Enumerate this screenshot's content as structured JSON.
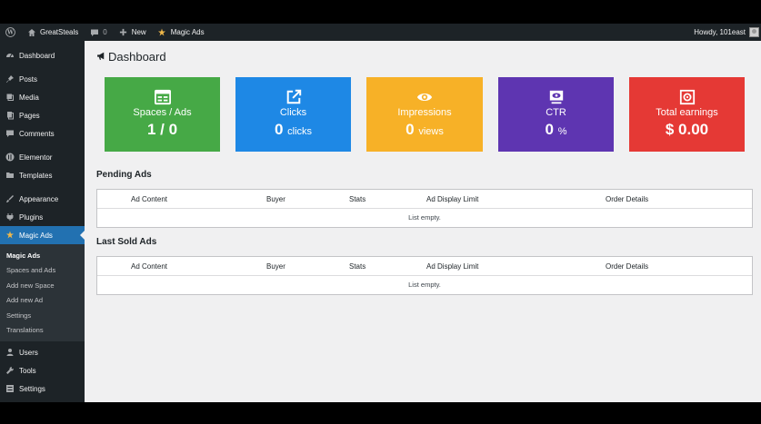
{
  "adminbar": {
    "site_name": "GreatSteals",
    "comments_count": "0",
    "new_label": "New",
    "plugin_label": "Magic Ads",
    "greeting": "Howdy, 101east"
  },
  "sidebar": {
    "items": [
      {
        "label": "Dashboard",
        "icon": "dashboard-icon"
      },
      {
        "label": "Posts",
        "icon": "pin-icon"
      },
      {
        "label": "Media",
        "icon": "media-icon"
      },
      {
        "label": "Pages",
        "icon": "pages-icon"
      },
      {
        "label": "Comments",
        "icon": "comments-icon"
      },
      {
        "label": "Elementor",
        "icon": "elementor-icon"
      },
      {
        "label": "Templates",
        "icon": "folder-icon"
      },
      {
        "label": "Appearance",
        "icon": "brush-icon"
      },
      {
        "label": "Plugins",
        "icon": "plug-icon"
      },
      {
        "label": "Magic Ads",
        "icon": "star-icon"
      }
    ],
    "submenu": [
      "Magic Ads",
      "Spaces and Ads",
      "Add new Space",
      "Add new Ad",
      "Settings",
      "Translations"
    ],
    "bottom_items": [
      {
        "label": "Users",
        "icon": "users-icon"
      },
      {
        "label": "Tools",
        "icon": "wrench-icon"
      },
      {
        "label": "Settings",
        "icon": "settings-icon"
      }
    ]
  },
  "page": {
    "title": "Dashboard"
  },
  "cards": [
    {
      "label": "Spaces / Ads",
      "value": "1 / 0",
      "unit": "",
      "color": "#46a946",
      "icon": "grid-icon"
    },
    {
      "label": "Clicks",
      "value": "0",
      "unit": "clicks",
      "color": "#1e88e5",
      "icon": "external-link-icon"
    },
    {
      "label": "Impressions",
      "value": "0",
      "unit": "views",
      "color": "#f7b127",
      "icon": "eye-icon"
    },
    {
      "label": "CTR",
      "value": "0",
      "unit": "%",
      "color": "#5e35b1",
      "icon": "monitor-icon"
    },
    {
      "label": "Total earnings",
      "value": "$ 0.00",
      "unit": "",
      "color": "#e53935",
      "icon": "safe-icon"
    }
  ],
  "pending": {
    "title": "Pending Ads",
    "headers": [
      "Ad Content",
      "Buyer",
      "Stats",
      "Ad Display Limit",
      "Order Details"
    ],
    "empty": "List empty."
  },
  "sold": {
    "title": "Last Sold Ads",
    "headers": [
      "Ad Content",
      "Buyer",
      "Stats",
      "Ad Display Limit",
      "Order Details"
    ],
    "empty": "List empty."
  }
}
